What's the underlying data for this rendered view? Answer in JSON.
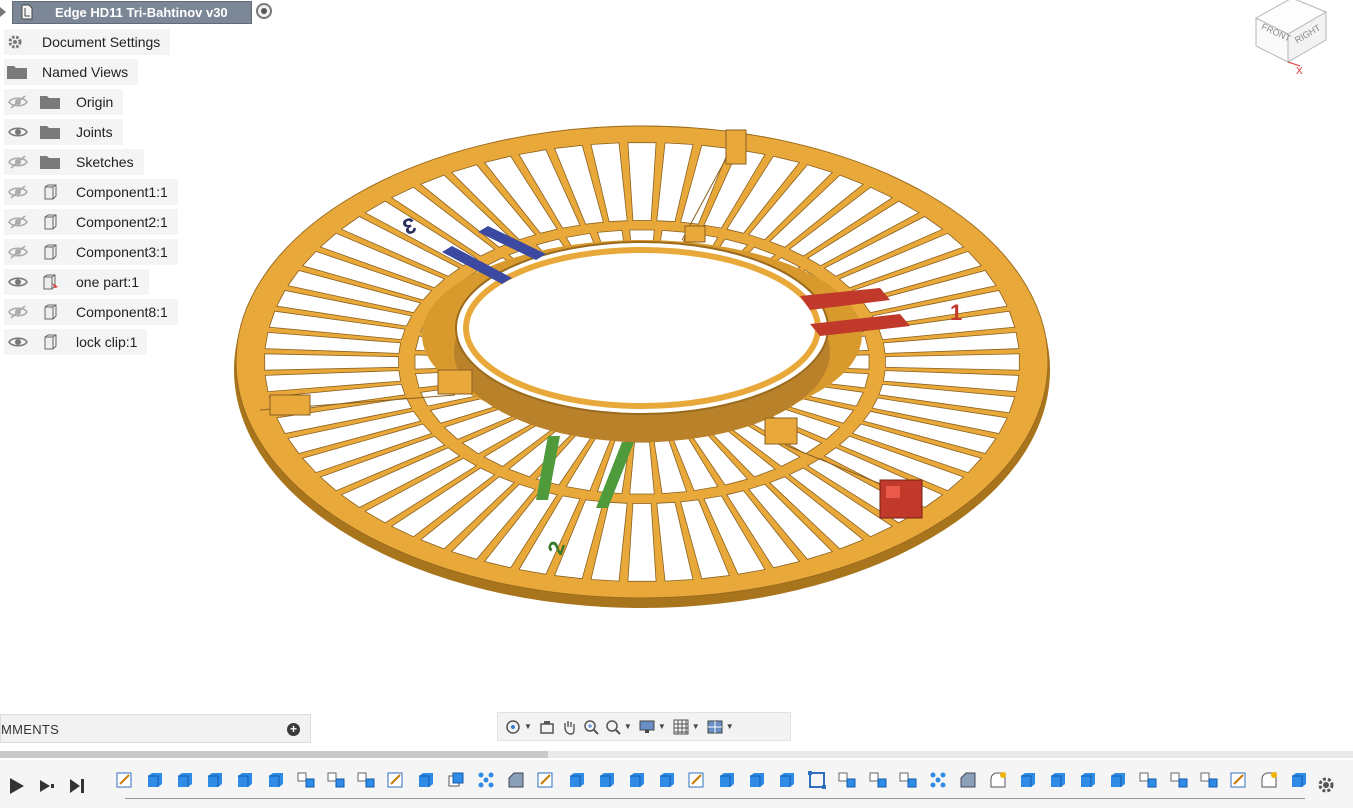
{
  "browser": {
    "root": {
      "label": "Edge HD11 Tri-Bahtinov v30"
    },
    "items": [
      {
        "label": "Document Settings",
        "icon": "gear-icon",
        "visible": null
      },
      {
        "label": "Named Views",
        "icon": "folder-icon",
        "visible": null
      },
      {
        "label": "Origin",
        "icon": "folder-icon",
        "visible": false
      },
      {
        "label": "Joints",
        "icon": "folder-icon",
        "visible": true
      },
      {
        "label": "Sketches",
        "icon": "folder-icon",
        "visible": false
      },
      {
        "label": "Component1:1",
        "icon": "component-icon",
        "visible": false
      },
      {
        "label": "Component2:1",
        "icon": "component-icon",
        "visible": false
      },
      {
        "label": "Component3:1",
        "icon": "component-icon",
        "visible": false
      },
      {
        "label": "one part:1",
        "icon": "component-pin-icon",
        "visible": true
      },
      {
        "label": "Component8:1",
        "icon": "component-icon",
        "visible": false
      },
      {
        "label": "lock clip:1",
        "icon": "component-icon",
        "visible": true
      }
    ]
  },
  "viewcube": {
    "front": "FRONT",
    "right": "RIGHT",
    "axis_x": "X"
  },
  "model": {
    "label_1": "1",
    "label_2": "2",
    "label_3": "3",
    "colors": {
      "body": "#e8a93a",
      "red": "#c0392b",
      "blue": "#3b4aa0",
      "green": "#4f9a3a"
    }
  },
  "comments": {
    "label": "MMENTS"
  },
  "nav_toolbar": {
    "tools": [
      "orbit-icon",
      "look-at-icon",
      "pan-icon",
      "zoom-icon",
      "fit-icon",
      "display-settings-icon",
      "grid-icon",
      "viewports-icon"
    ]
  },
  "timeline": {
    "controls": [
      "play-icon",
      "step-forward-icon",
      "end-icon"
    ],
    "features": [
      "sketch",
      "extrude",
      "extrude",
      "extrude",
      "extrude",
      "extrude",
      "joint",
      "joint",
      "joint",
      "sketch",
      "extrude",
      "box",
      "pattern",
      "chamfer",
      "sketch",
      "extrude",
      "extrude",
      "extrude",
      "extrude",
      "sketch",
      "extrude",
      "extrude",
      "extrude",
      "component",
      "joint",
      "joint",
      "joint",
      "pattern",
      "chamfer",
      "fillet",
      "extrude",
      "extrude",
      "extrude",
      "extrude",
      "joint",
      "joint",
      "joint",
      "sketch",
      "fillet",
      "extrude"
    ]
  }
}
